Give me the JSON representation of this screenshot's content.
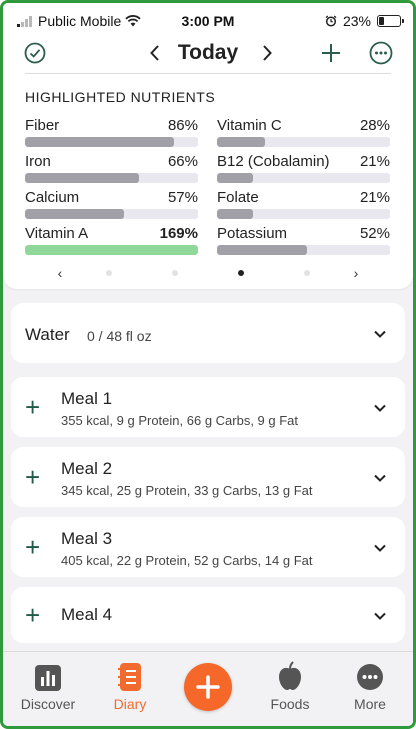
{
  "status_bar": {
    "carrier": "Public Mobile",
    "time": "3:00 PM",
    "battery": "23%"
  },
  "header": {
    "title": "Today"
  },
  "nutrients": {
    "heading": "HIGHLIGHTED NUTRIENTS",
    "items": [
      {
        "name": "Fiber",
        "percent": "86%",
        "value": 86
      },
      {
        "name": "Vitamin C",
        "percent": "28%",
        "value": 28
      },
      {
        "name": "Iron",
        "percent": "66%",
        "value": 66
      },
      {
        "name": "B12 (Cobalamin)",
        "percent": "21%",
        "value": 21
      },
      {
        "name": "Calcium",
        "percent": "57%",
        "value": 57
      },
      {
        "name": "Folate",
        "percent": "21%",
        "value": 21
      },
      {
        "name": "Vitamin A",
        "percent": "169%",
        "value": 169
      },
      {
        "name": "Potassium",
        "percent": "52%",
        "value": 52
      }
    ],
    "page_prev": "‹",
    "page_next": "›",
    "active_page": 3,
    "page_count": 4
  },
  "water": {
    "label": "Water",
    "amount": "0 / 48 fl oz"
  },
  "meals": [
    {
      "title": "Meal 1",
      "summary": "355 kcal, 9 g Protein, 66 g Carbs, 9 g Fat"
    },
    {
      "title": "Meal 2",
      "summary": "345 kcal, 25 g Protein, 33 g Carbs, 13 g Fat"
    },
    {
      "title": "Meal 3",
      "summary": "405 kcal, 22 g Protein, 52 g Carbs, 14 g Fat"
    },
    {
      "title": "Meal 4",
      "summary": ""
    }
  ],
  "tabs": [
    {
      "label": "Discover",
      "icon": "bar-chart-icon"
    },
    {
      "label": "Diary",
      "icon": "notebook-icon",
      "active": true
    },
    {
      "label": "Foods",
      "icon": "apple-icon"
    },
    {
      "label": "More",
      "icon": "more-dots-icon"
    }
  ],
  "colors": {
    "accent_orange": "#f6672a",
    "accent_green": "#1f5a44",
    "highlight_bar": "#8fd89a",
    "frame_border": "#2e9a3c"
  }
}
